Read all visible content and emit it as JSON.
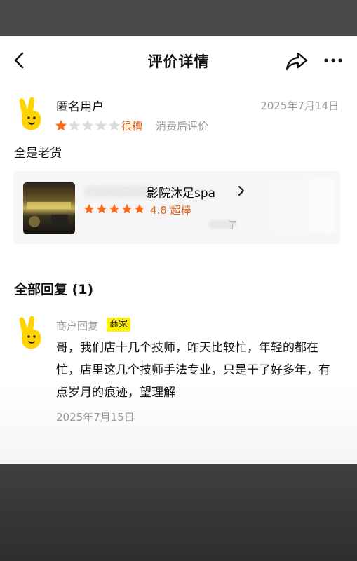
{
  "nav": {
    "title": "评价详情",
    "back_icon": "back-arrow-icon",
    "share_icon": "share-icon",
    "more_icon": "more-icon"
  },
  "review": {
    "username": "匿名用户",
    "date": "2025年7月14日",
    "rating": 1,
    "rating_max": 5,
    "rating_text": "很糟",
    "rating_sub": "消费后评价",
    "content": "全是老货"
  },
  "shop": {
    "name": "影院沐足spa",
    "rating": 4.8,
    "score_text": "4.8 超棒",
    "extra": "了"
  },
  "replies": {
    "heading": "全部回复 (1)",
    "items": [
      {
        "author": "商户回复",
        "badge": "商家",
        "text": "哥，我们店十几个技师，昨天比较忙，年轻的都在忙，店里这几个技师手法专业，只是干了好多年，有点岁月的痕迹，望理解",
        "date": "2025年7月15日"
      }
    ]
  },
  "colors": {
    "accent": "#e0661f",
    "star_filled": "#ff6a1a",
    "star_empty": "#dddddd",
    "badge_bg": "#fff200",
    "avatar_yellow": "#ffd400"
  }
}
